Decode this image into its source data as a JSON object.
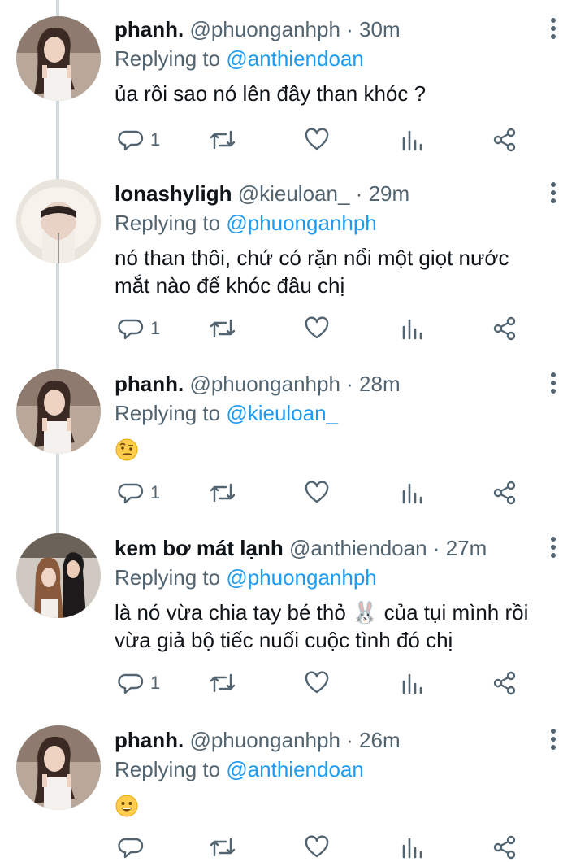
{
  "tweets": [
    {
      "name": "phanh.",
      "handle": "@phuonganhph",
      "sep": "·",
      "time": "30m",
      "replying_label": "Replying to",
      "replying_to": "@anthiendoan",
      "text_lines": [
        "ủa rồi sao nó lên đây than khóc ?"
      ],
      "emoji": "",
      "reply_count": "1",
      "avatar": "woman-portrait-1"
    },
    {
      "name": "lonashyligh",
      "handle": "@kieuloan_",
      "sep": "·",
      "time": "29m",
      "replying_label": "Replying to",
      "replying_to": "@phuonganhph",
      "text_lines": [
        "nó than thôi, chứ có rặn nổi một giọt nước",
        "mắt nào để khóc đâu chị"
      ],
      "emoji": "",
      "reply_count": "1",
      "avatar": "woman-fur-hood"
    },
    {
      "name": "phanh.",
      "handle": "@phuonganhph",
      "sep": "·",
      "time": "28m",
      "replying_label": "Replying to",
      "replying_to": "@kieuloan_",
      "text_lines": [],
      "emoji": "raised-eyebrow-face",
      "reply_count": "1",
      "avatar": "woman-portrait-1"
    },
    {
      "name": "kem bơ mát lạnh",
      "handle": "@anthiendoan",
      "sep": "·",
      "time": "27m",
      "replying_label": "Replying to",
      "replying_to": "@phuonganhph",
      "text_lines": [
        "là nó vừa chia tay bé thỏ 🐰 của tụi mình rồi",
        "vừa giả bộ tiếc nuối cuộc tình đó chị"
      ],
      "emoji": "",
      "reply_count": "1",
      "avatar": "two-women-photo"
    },
    {
      "name": "phanh.",
      "handle": "@phuonganhph",
      "sep": "·",
      "time": "26m",
      "replying_label": "Replying to",
      "replying_to": "@anthiendoan",
      "text_lines": [],
      "emoji": "grinning-face",
      "reply_count": "",
      "avatar": "woman-portrait-1"
    }
  ],
  "icons": {
    "reply": "reply-icon",
    "retweet": "retweet-icon",
    "like": "heart-icon",
    "stats": "stats-icon",
    "share": "share-icon",
    "more": "more-icon"
  },
  "colors": {
    "accent": "#1d9bf0",
    "muted": "#536471",
    "thread": "#cfd9de"
  }
}
